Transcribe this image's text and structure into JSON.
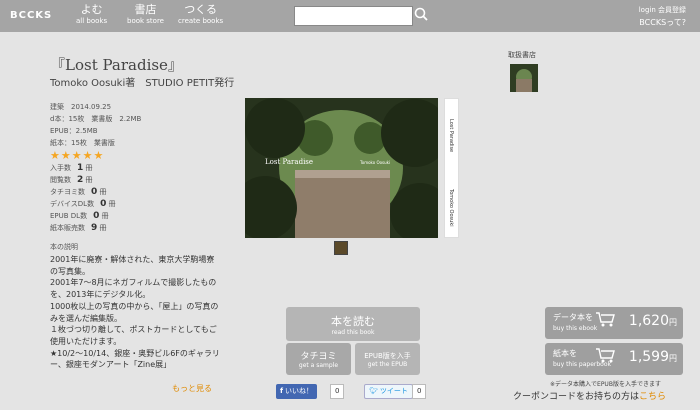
{
  "header": {
    "logo": "BCCKS",
    "nav": [
      {
        "jp": "よむ",
        "en": "all books"
      },
      {
        "jp": "書店",
        "en": "book store"
      },
      {
        "jp": "つくる",
        "en": "create books"
      }
    ],
    "search": {
      "placeholder": "",
      "value": ""
    },
    "login": "login 会員登録",
    "what": "BCCKSって?"
  },
  "book": {
    "title": "『Lost Paradise』",
    "author": "Tomoko Oosuki著　STUDIO PETIT発行",
    "meta": [
      "建築　2014.09.25",
      "d本：15枚　業書版　2.2MB",
      "EPUB：2.5MB",
      "紙本：15枚　業書版"
    ],
    "stars": "★★★★★",
    "stats": [
      {
        "label": "入手数",
        "value": "1",
        "unit": "冊"
      },
      {
        "label": "閲覧数",
        "value": "2",
        "unit": "冊"
      },
      {
        "label": "タチヨミ数",
        "value": "0",
        "unit": "冊"
      },
      {
        "label": "デバイスDL数",
        "value": "0",
        "unit": "冊"
      },
      {
        "label": "EPUB DL数",
        "value": "0",
        "unit": "冊"
      },
      {
        "label": "紙本販売数",
        "value": "9",
        "unit": "冊"
      }
    ],
    "description_label": "本の説明",
    "description": [
      "2001年に廃寮・解体された、東京大学駒場寮の写真集。",
      "2001年7〜8月にネガフィルムで撮影したものを、2013年にデジタル化。",
      "1000枚以上の写真の中から、「屋上」の写真のみを選んだ編集版。",
      "１枚づつ切り離して、ポストカードとしてもご使用いただけます。",
      "★10/2〜10/14、銀座・奥野ビル6Fのギャラリー、銀座モダンアート「Zine展」"
    ],
    "more": "もっと見る",
    "cover_title": "Lost Paradise",
    "cover_author": "Tomoko Oosuki",
    "spine_title": "Lost Paradise",
    "spine_author": "Tomoko Oosuki"
  },
  "store": {
    "label": "取扱書店"
  },
  "actions": {
    "read": {
      "jp": "本を読む",
      "en": "read this book"
    },
    "sample": {
      "jp": "タチヨミ",
      "en": "get a sample"
    },
    "epub": {
      "jp": "EPUB版を入手",
      "en": "get the EPUB"
    }
  },
  "purchase": {
    "ebook": {
      "label": "データ本を",
      "sub": "buy this ebook",
      "price": "1,620",
      "unit": "円"
    },
    "paper": {
      "label": "紙本を",
      "sub": "buy this paperbook",
      "price": "1,599",
      "unit": "円"
    },
    "note": "※データ本購入でEPUB版を入手できます",
    "coupon_text": "クーポンコードをお持ちの方は",
    "coupon_link": "こちら"
  },
  "social": {
    "like": "いいね！",
    "like_count": "0",
    "tweet": "ツイート",
    "tweet_count": "0"
  }
}
